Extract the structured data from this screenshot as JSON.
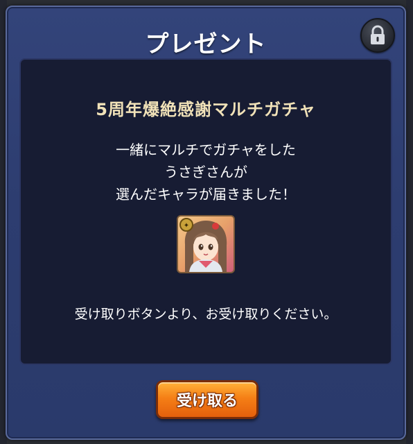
{
  "dialog": {
    "title": "プレゼント",
    "lock_icon": "lock-icon"
  },
  "panel": {
    "heading": "5周年爆絶感謝マルチガチャ",
    "message_lines": [
      "一緒にマルチでガチャをした",
      "うさぎさんが",
      "選んだキャラが届きました！"
    ],
    "character_icon": "character-portrait-icon",
    "instruction": "受け取りボタンより、お受け取りください。"
  },
  "buttons": {
    "receive_label": "受け取る"
  },
  "colors": {
    "frame": "#33447a",
    "panel": "#171c33",
    "heading_text": "#f1e2b8",
    "button_orange": "#f57f16",
    "button_border": "#7a2d08"
  }
}
